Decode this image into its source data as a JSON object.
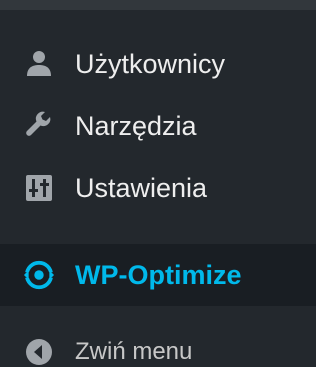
{
  "menu": {
    "items": [
      {
        "label": "Użytkownicy",
        "icon": "users-icon"
      },
      {
        "label": "Narzędzia",
        "icon": "wrench-icon"
      },
      {
        "label": "Ustawienia",
        "icon": "settings-sliders-icon"
      },
      {
        "label": "WP-Optimize",
        "icon": "wp-optimize-icon",
        "active": true
      },
      {
        "label": "Zwiń menu",
        "icon": "collapse-arrow-icon"
      }
    ]
  },
  "colors": {
    "sidebar_bg": "#23282d",
    "active_bg": "#191e23",
    "accent": "#00b9eb",
    "text": "#eeeeee"
  }
}
